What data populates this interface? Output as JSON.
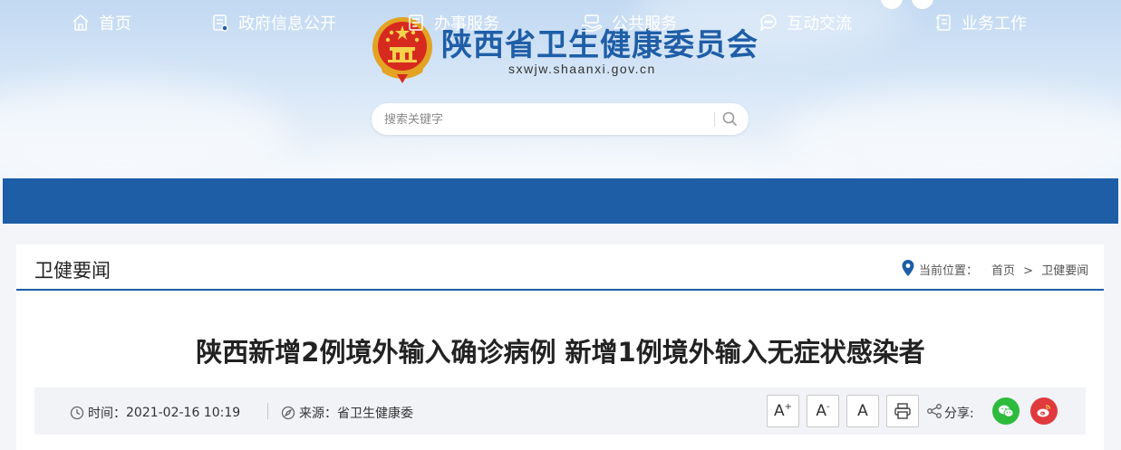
{
  "site": {
    "title": "陕西省卫生健康委员会",
    "domain": "sxwjw.shaanxi.gov.cn"
  },
  "search": {
    "placeholder": "搜索关键字"
  },
  "nav": {
    "items": [
      {
        "label": "首页",
        "icon": "home-icon"
      },
      {
        "label": "政府信息公开",
        "icon": "document-list-icon"
      },
      {
        "label": "办事服务",
        "icon": "form-icon"
      },
      {
        "label": "公共服务",
        "icon": "hand-service-icon"
      },
      {
        "label": "互动交流",
        "icon": "chat-icon"
      },
      {
        "label": "业务工作",
        "icon": "book-icon"
      }
    ]
  },
  "section": {
    "title": "卫健要闻",
    "location_label": "当前位置：",
    "breadcrumb": [
      "首页",
      "卫健要闻"
    ],
    "breadcrumb_sep": ">"
  },
  "article": {
    "title": "陕西新增2例境外输入确诊病例 新增1例境外输入无症状感染者",
    "time_label": "时间：",
    "time": "2021-02-16 10:19",
    "source_label": "来源：",
    "source": "省卫生健康委",
    "font_sizes": [
      "A",
      "A",
      "A"
    ],
    "font_size_marks": [
      "+",
      "-",
      ""
    ],
    "share_label": "分享:"
  },
  "colors": {
    "brand_blue": "#1d5ea6",
    "wechat_green": "#2dbb3c",
    "weibo_red": "#e0393e"
  }
}
